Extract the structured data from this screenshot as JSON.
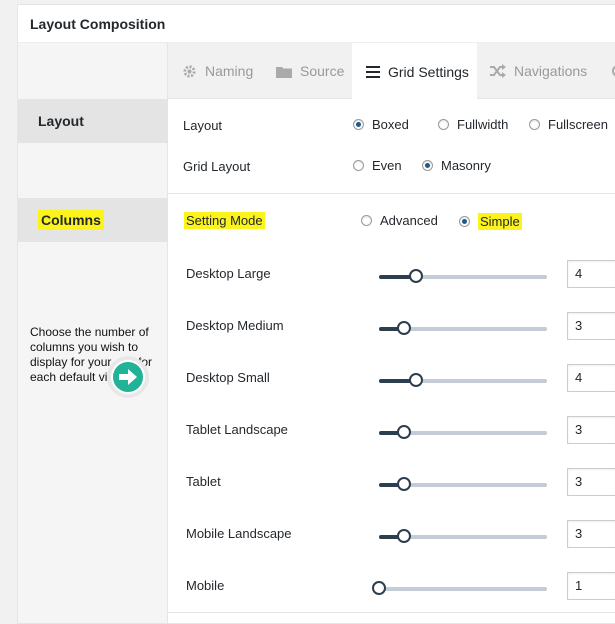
{
  "panel": {
    "title": "Layout Composition"
  },
  "sidebar": {
    "layout_label": "Layout",
    "columns_label": "Columns",
    "description": "Choose the number of columns you wish to display for your grid for each default viewport."
  },
  "tabs": [
    {
      "label": "Naming",
      "icon": "gear-icon"
    },
    {
      "label": "Source",
      "icon": "folder-icon"
    },
    {
      "label": "Grid Settings",
      "icon": "hamburger-icon",
      "active": true
    },
    {
      "label": "Navigations",
      "icon": "shuffle-icon"
    },
    {
      "label": "",
      "icon": "partial-icon"
    }
  ],
  "layout_row": {
    "label": "Layout",
    "options": [
      "Boxed",
      "Fullwidth",
      "Fullscreen"
    ],
    "selected": "Boxed"
  },
  "grid_layout_row": {
    "label": "Grid Layout",
    "options": [
      "Even",
      "Masonry"
    ],
    "selected": "Masonry"
  },
  "setting_mode_row": {
    "label": "Setting Mode",
    "options": [
      "Advanced",
      "Simple"
    ],
    "selected": "Simple"
  },
  "sliders": [
    {
      "label": "Desktop Large",
      "value": "4",
      "level": 0.22
    },
    {
      "label": "Desktop Medium",
      "value": "3",
      "level": 0.15
    },
    {
      "label": "Desktop Small",
      "value": "4",
      "level": 0.22
    },
    {
      "label": "Tablet Landscape",
      "value": "3",
      "level": 0.15
    },
    {
      "label": "Tablet",
      "value": "3",
      "level": 0.15
    },
    {
      "label": "Mobile Landscape",
      "value": "3",
      "level": 0.15
    },
    {
      "label": "Mobile",
      "value": "1",
      "level": 0.0
    }
  ],
  "colors": {
    "highlight": "#fbf31b",
    "accent": "#21b398",
    "slider_dark": "#2c3e50",
    "radio_on": "#1e5a8a"
  }
}
